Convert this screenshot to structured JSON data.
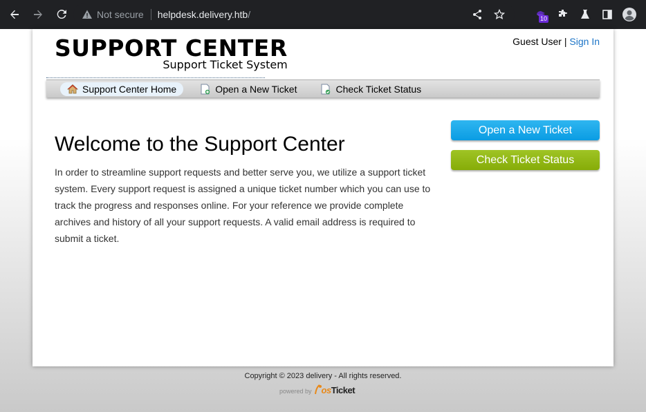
{
  "browser": {
    "security_label": "Not secure",
    "url_host": "helpdesk.delivery.htb",
    "url_path": "/",
    "extension_badge": "10",
    "icons": [
      "back-icon",
      "forward-icon",
      "reload-icon",
      "warning-icon",
      "share-icon",
      "star-icon",
      "extension-icon",
      "puzzle-icon",
      "labs-icon",
      "sidepanel-icon",
      "profile-icon"
    ]
  },
  "header": {
    "logo_title": "SUPPORT CENTER",
    "logo_subtitle": "Support Ticket System",
    "user_label": "Guest User",
    "separator": "|",
    "sign_in_label": "Sign In"
  },
  "nav": {
    "items": [
      {
        "label": "Support Center Home",
        "icon": "home-icon",
        "active": true
      },
      {
        "label": "Open a New Ticket",
        "icon": "new-ticket-icon",
        "active": false
      },
      {
        "label": "Check Ticket Status",
        "icon": "ticket-status-icon",
        "active": false
      }
    ]
  },
  "main": {
    "heading": "Welcome to the Support Center",
    "intro": "In order to streamline support requests and better serve you, we utilize a support ticket system. Every support request is assigned a unique ticket number which you can use to track the progress and responses online. For your reference we provide complete archives and history of all your support requests. A valid email address is required to submit a ticket."
  },
  "sidebar": {
    "open_ticket_label": "Open a New Ticket",
    "check_status_label": "Check Ticket Status",
    "colors": {
      "open": "#0a9ce3",
      "check": "#86ac08"
    }
  },
  "footer": {
    "copyright": "Copyright © 2023 delivery - All rights reserved.",
    "powered_by": "powered by",
    "brand_os": "os",
    "brand_ticket": "Ticket"
  },
  "colors": {
    "chrome_bg": "#202124",
    "link": "#1b74c7"
  }
}
